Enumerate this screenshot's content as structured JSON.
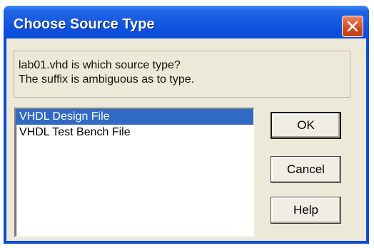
{
  "window": {
    "title": "Choose Source Type"
  },
  "message": {
    "line1": "lab01.vhd is which source type?",
    "line2": "The suffix is ambiguous as to type."
  },
  "source_types": {
    "items": [
      "VHDL Design File",
      "VHDL Test Bench File"
    ],
    "selected": "VHDL Design File"
  },
  "buttons": {
    "ok": "OK",
    "cancel": "Cancel",
    "help": "Help"
  },
  "colors": {
    "titlebar": "#0a4bd8",
    "selection": "#316ac5",
    "dialog_background": "#ece9d8"
  }
}
